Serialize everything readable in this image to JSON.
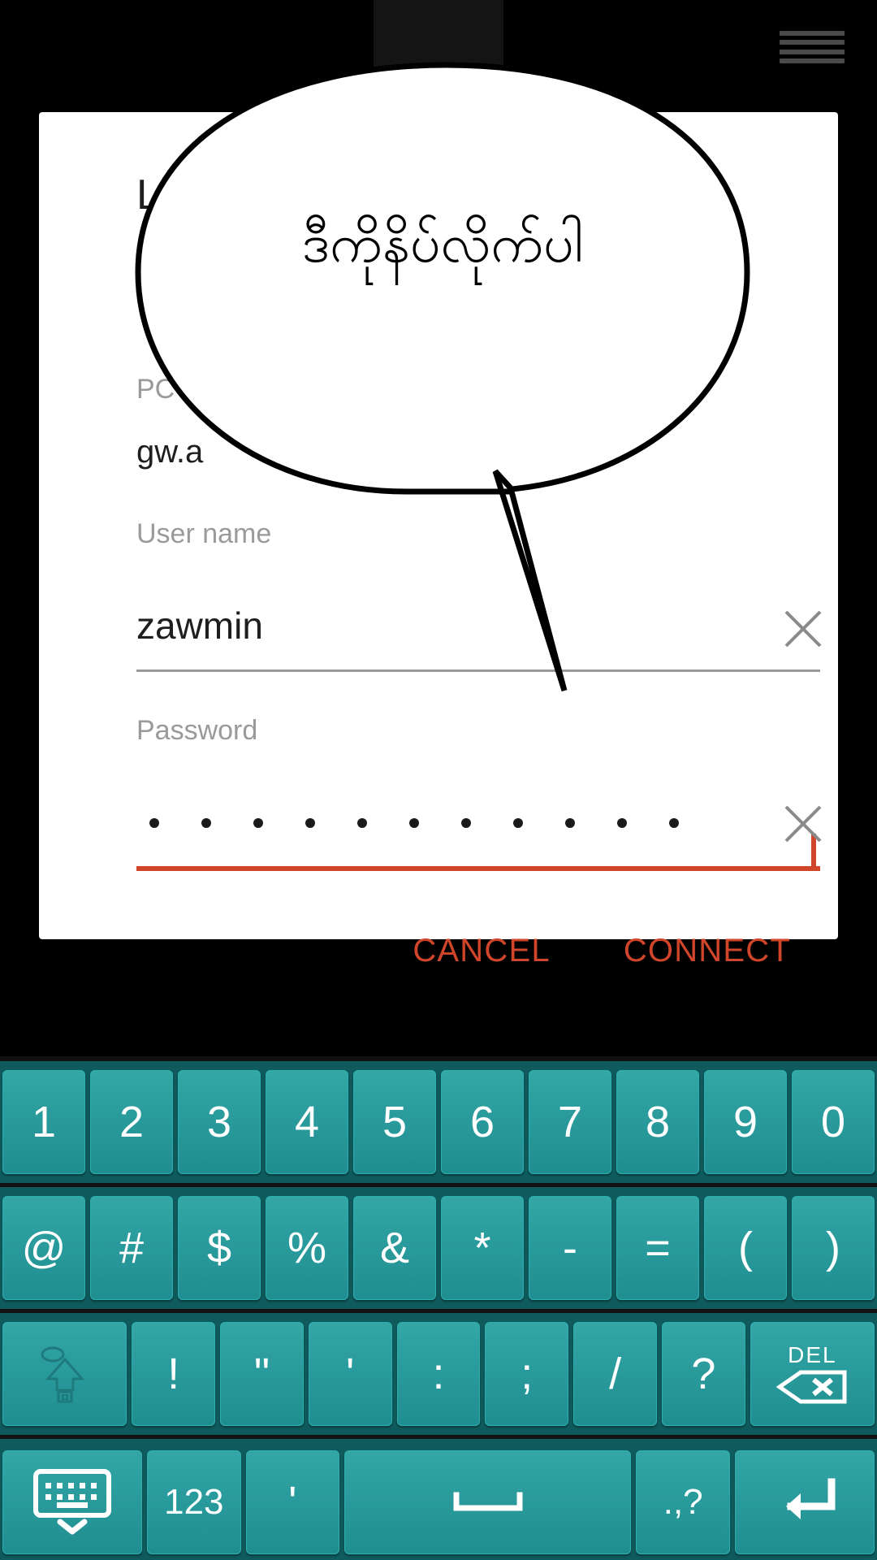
{
  "dialog": {
    "title": "Logon",
    "pc_name_label": "PC name",
    "pc_name_value": "gw.a",
    "user_name_label": "User name",
    "user_name_value": "zawmin",
    "password_label": "Password",
    "password_masked_count": 11,
    "clear_user_icon": "close-x-icon",
    "clear_password_icon": "close-x-icon",
    "cancel_label": "CANCEL",
    "connect_label": "CONNECT",
    "accent_color": "#d1452a",
    "title_color": "#1e1e1e",
    "label_color": "#9a9a9a"
  },
  "bubble": {
    "text": "ဒီကိုနိပ်လိုက်ပါ",
    "outline_color": "#000000",
    "fill_color": "#ffffff"
  },
  "topbar": {
    "handle_icon": "drag-handle-icon",
    "background": "#000000"
  },
  "keyboard": {
    "background": "#0e5a5c",
    "key_color": "#2a9b9c",
    "key_text_color": "#ffffff",
    "rows": [
      {
        "name": "digits-row",
        "keys": [
          {
            "label": "1",
            "name": "key-1",
            "type": "char"
          },
          {
            "label": "2",
            "name": "key-2",
            "type": "char"
          },
          {
            "label": "3",
            "name": "key-3",
            "type": "char"
          },
          {
            "label": "4",
            "name": "key-4",
            "type": "char"
          },
          {
            "label": "5",
            "name": "key-5",
            "type": "char"
          },
          {
            "label": "6",
            "name": "key-6",
            "type": "char"
          },
          {
            "label": "7",
            "name": "key-7",
            "type": "char"
          },
          {
            "label": "8",
            "name": "key-8",
            "type": "char"
          },
          {
            "label": "9",
            "name": "key-9",
            "type": "char"
          },
          {
            "label": "0",
            "name": "key-0",
            "type": "char"
          }
        ]
      },
      {
        "name": "symbols-row-1",
        "keys": [
          {
            "label": "@",
            "name": "key-at",
            "type": "char"
          },
          {
            "label": "#",
            "name": "key-hash",
            "type": "char"
          },
          {
            "label": "$",
            "name": "key-dollar",
            "type": "char"
          },
          {
            "label": "%",
            "name": "key-percent",
            "type": "char"
          },
          {
            "label": "&",
            "name": "key-ampersand",
            "type": "char"
          },
          {
            "label": "*",
            "name": "key-asterisk",
            "type": "char"
          },
          {
            "label": "-",
            "name": "key-hyphen",
            "type": "char"
          },
          {
            "label": "=",
            "name": "key-equals",
            "type": "char"
          },
          {
            "label": "(",
            "name": "key-paren-open",
            "type": "char"
          },
          {
            "label": ")",
            "name": "key-paren-close",
            "type": "char"
          }
        ]
      },
      {
        "name": "symbols-row-2",
        "keys": [
          {
            "label": "",
            "name": "key-shift-symbols",
            "type": "shift-icon"
          },
          {
            "label": "!",
            "name": "key-exclamation",
            "type": "char"
          },
          {
            "label": "\"",
            "name": "key-double-quote",
            "type": "char"
          },
          {
            "label": "'",
            "name": "key-apostrophe",
            "type": "char"
          },
          {
            "label": ":",
            "name": "key-colon",
            "type": "char"
          },
          {
            "label": ";",
            "name": "key-semicolon",
            "type": "char"
          },
          {
            "label": "/",
            "name": "key-slash",
            "type": "char"
          },
          {
            "label": "?",
            "name": "key-question",
            "type": "char"
          },
          {
            "label": "DEL",
            "name": "key-delete",
            "type": "delete-icon"
          }
        ]
      },
      {
        "name": "bottom-row",
        "keys": [
          {
            "label": "",
            "name": "key-hide-keyboard",
            "type": "keyboard-hide-icon"
          },
          {
            "label": "123",
            "name": "key-numeric-mode",
            "type": "char"
          },
          {
            "label": "'",
            "name": "key-apostrophe-2",
            "type": "char"
          },
          {
            "label": "",
            "name": "key-space",
            "type": "space-icon"
          },
          {
            "label": ".,?",
            "name": "key-punctuation",
            "type": "char"
          },
          {
            "label": "",
            "name": "key-enter",
            "type": "enter-icon"
          }
        ]
      }
    ]
  }
}
